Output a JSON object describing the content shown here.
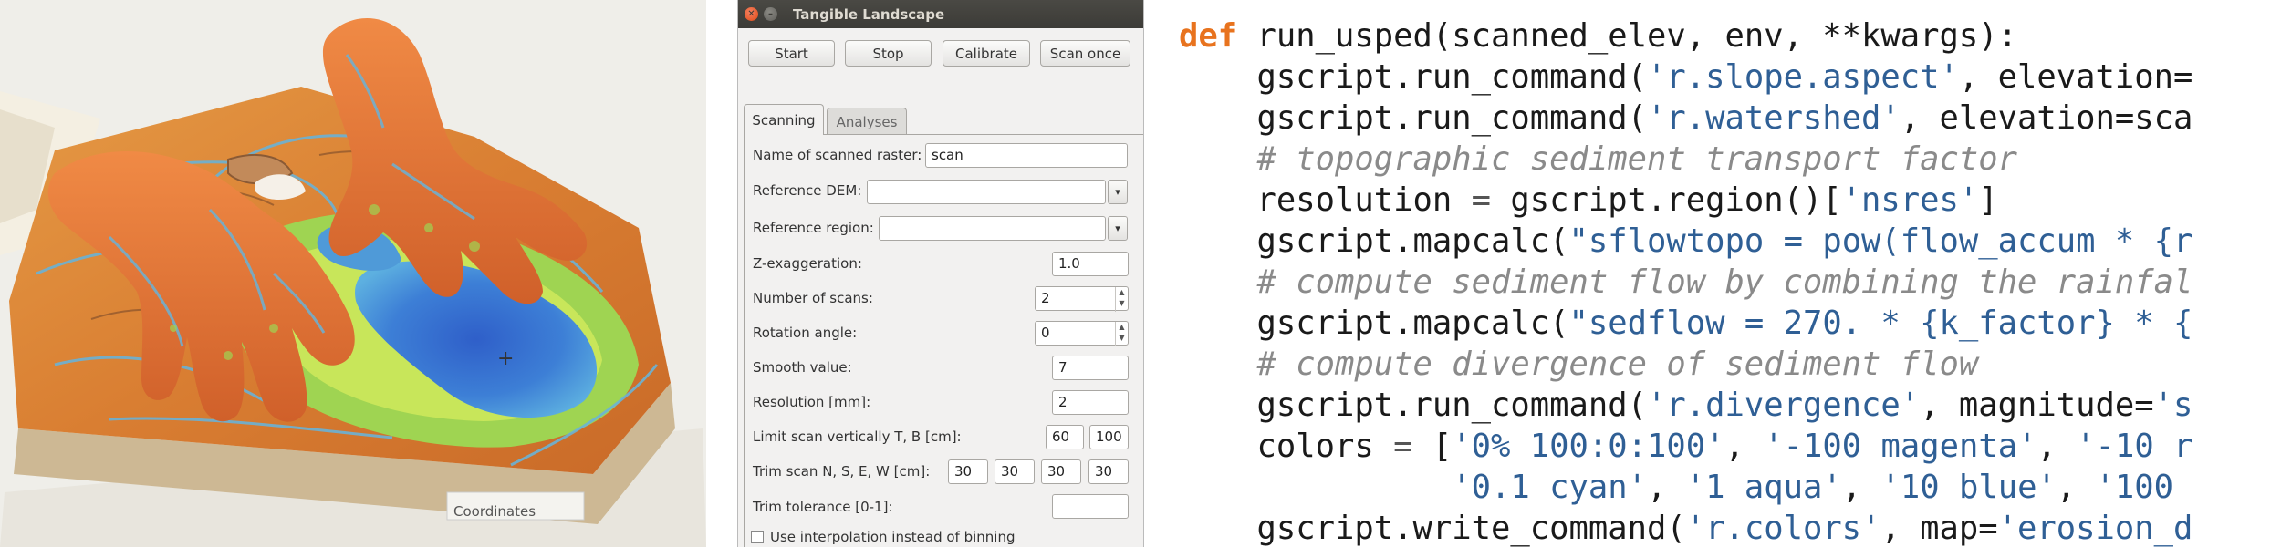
{
  "photo": {
    "caption": "Coordinates",
    "colors": {
      "sand": "#e08a3a",
      "water": "#3c7fd4",
      "green": "#8fd14a",
      "contour": "#6aa8c8",
      "skin": "#e0763a"
    }
  },
  "window": {
    "title": "Tangible Landscape",
    "toolbar": {
      "start": "Start",
      "stop": "Stop",
      "calibrate": "Calibrate",
      "scan_once": "Scan once"
    },
    "tabs": [
      {
        "label": "Scanning",
        "active": true
      },
      {
        "label": "Analyses",
        "active": false
      }
    ],
    "fields": {
      "scanned_raster": {
        "label": "Name of scanned raster:",
        "value": "scan"
      },
      "reference_dem": {
        "label": "Reference DEM:",
        "value": ""
      },
      "reference_region": {
        "label": "Reference region:",
        "value": ""
      },
      "z_exaggeration": {
        "label": "Z-exaggeration:",
        "value": "1.0"
      },
      "number_of_scans": {
        "label": "Number of scans:",
        "value": "2"
      },
      "rotation_angle": {
        "label": "Rotation angle:",
        "value": "0"
      },
      "smooth_value": {
        "label": "Smooth value:",
        "value": "7"
      },
      "resolution": {
        "label": "Resolution [mm]:",
        "value": "2"
      },
      "limit_scan": {
        "label": "Limit scan vertically T, B [cm]:",
        "values": [
          "60",
          "100"
        ]
      },
      "trim_scan": {
        "label": "Trim scan N, S, E, W [cm]:",
        "values": [
          "30",
          "30",
          "30",
          "30"
        ]
      },
      "trim_tolerance": {
        "label": "Trim tolerance [0-1]:",
        "value": ""
      },
      "interpolation": {
        "label": "Use interpolation instead of binning",
        "checked": false
      }
    }
  },
  "code": {
    "colors": {
      "keyword": "#e8731e",
      "string": "#2f5f95",
      "comment": "#8a8a8a"
    },
    "lines": [
      [
        {
          "t": "kw",
          "v": "def"
        },
        {
          "t": "tx",
          "v": " run_usped(scanned_elev, env, **kwargs):"
        }
      ],
      [
        {
          "t": "tx",
          "v": "    gscript.run_command("
        },
        {
          "t": "st",
          "v": "'r.slope.aspect'"
        },
        {
          "t": "tx",
          "v": ", elevation="
        }
      ],
      [
        {
          "t": "tx",
          "v": "    gscript.run_command("
        },
        {
          "t": "st",
          "v": "'r.watershed'"
        },
        {
          "t": "tx",
          "v": ", elevation=sca"
        }
      ],
      [
        {
          "t": "cm",
          "v": "    # topographic sediment transport factor"
        }
      ],
      [
        {
          "t": "tx",
          "v": "    resolution "
        },
        {
          "t": "op",
          "v": "="
        },
        {
          "t": "tx",
          "v": " gscript.region()["
        },
        {
          "t": "st",
          "v": "'nsres'"
        },
        {
          "t": "tx",
          "v": "]"
        }
      ],
      [
        {
          "t": "tx",
          "v": "    gscript.mapcalc("
        },
        {
          "t": "st",
          "v": "\"sflowtopo = pow(flow_accum * {r"
        }
      ],
      [
        {
          "t": "cm",
          "v": "    # compute sediment flow by combining the rainfal"
        }
      ],
      [
        {
          "t": "tx",
          "v": "    gscript.mapcalc("
        },
        {
          "t": "st",
          "v": "\"sedflow = 270. * {k_factor} * {"
        }
      ],
      [
        {
          "t": "cm",
          "v": "    # compute divergence of sediment flow"
        }
      ],
      [
        {
          "t": "tx",
          "v": "    gscript.run_command("
        },
        {
          "t": "st",
          "v": "'r.divergence'"
        },
        {
          "t": "tx",
          "v": ", magnitude="
        },
        {
          "t": "st",
          "v": "'s"
        }
      ],
      [
        {
          "t": "tx",
          "v": "    colors "
        },
        {
          "t": "op",
          "v": "="
        },
        {
          "t": "tx",
          "v": " ["
        },
        {
          "t": "st",
          "v": "'0% 100:0:100'"
        },
        {
          "t": "tx",
          "v": ", "
        },
        {
          "t": "st",
          "v": "'-100 magenta'"
        },
        {
          "t": "tx",
          "v": ", "
        },
        {
          "t": "st",
          "v": "'-10 r"
        }
      ],
      [
        {
          "t": "tx",
          "v": "              "
        },
        {
          "t": "st",
          "v": "'0.1 cyan'"
        },
        {
          "t": "tx",
          "v": ", "
        },
        {
          "t": "st",
          "v": "'1 aqua'"
        },
        {
          "t": "tx",
          "v": ", "
        },
        {
          "t": "st",
          "v": "'10 blue'"
        },
        {
          "t": "tx",
          "v": ", "
        },
        {
          "t": "st",
          "v": "'100"
        }
      ],
      [
        {
          "t": "tx",
          "v": "    gscript.write_command("
        },
        {
          "t": "st",
          "v": "'r.colors'"
        },
        {
          "t": "tx",
          "v": ", map="
        },
        {
          "t": "st",
          "v": "'erosion_d"
        }
      ]
    ]
  }
}
